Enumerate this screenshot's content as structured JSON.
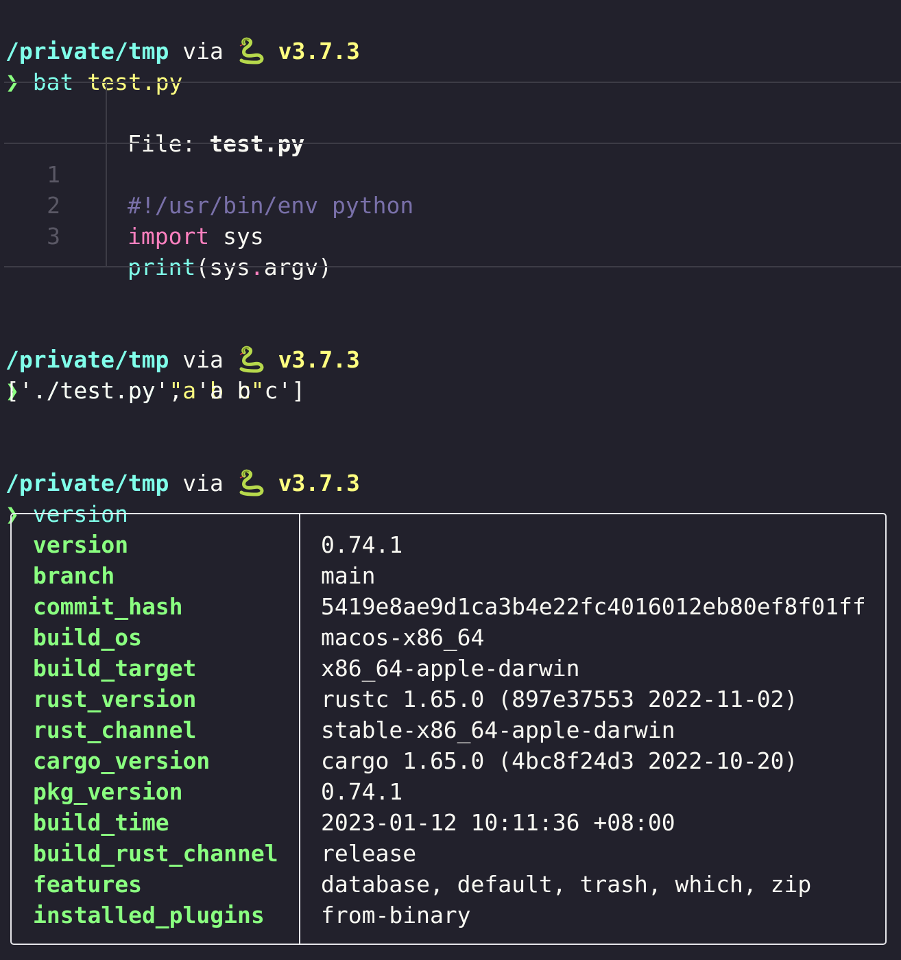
{
  "prompt1": {
    "path": "/private/tmp",
    "via": "via",
    "python_version": "v3.7.3",
    "chevron": "❯",
    "command": "bat",
    "argument": "test.py"
  },
  "bat": {
    "file_label": "File: ",
    "file_name": "test.py",
    "lines": [
      {
        "num": "1",
        "shebang": "#!/usr/bin/env python"
      },
      {
        "num": "2",
        "keyword": "import",
        "rest": " sys"
      },
      {
        "num": "3",
        "func": "print",
        "open": "(sys",
        "dot": ".",
        "close": "argv)"
      }
    ]
  },
  "prompt2": {
    "path": "/private/tmp",
    "via": "via",
    "python_version": "v3.7.3",
    "chevron": "❯",
    "command": "./test.py",
    "argument": "\"a b c\"",
    "output": "['./test.py', 'a b c']"
  },
  "prompt3": {
    "path": "/private/tmp",
    "via": "via",
    "python_version": "v3.7.3",
    "chevron": "❯",
    "command": "version"
  },
  "version_table": [
    {
      "key": "version",
      "value": "0.74.1"
    },
    {
      "key": "branch",
      "value": "main"
    },
    {
      "key": "commit_hash",
      "value": "5419e8ae9d1ca3b4e22fc4016012eb80ef8f01ff"
    },
    {
      "key": "build_os",
      "value": "macos-x86_64"
    },
    {
      "key": "build_target",
      "value": "x86_64-apple-darwin"
    },
    {
      "key": "rust_version",
      "value": "rustc 1.65.0 (897e37553 2022-11-02)"
    },
    {
      "key": "rust_channel",
      "value": "stable-x86_64-apple-darwin"
    },
    {
      "key": "cargo_version",
      "value": "cargo 1.65.0 (4bc8f24d3 2022-10-20)"
    },
    {
      "key": "pkg_version",
      "value": "0.74.1"
    },
    {
      "key": "build_time",
      "value": "2023-01-12 10:11:36 +08:00"
    },
    {
      "key": "build_rust_channel",
      "value": "release"
    },
    {
      "key": "features",
      "value": "database, default, trash, which, zip"
    },
    {
      "key": "installed_plugins",
      "value": "from-binary"
    }
  ],
  "icons": {
    "python": "snake-icon"
  },
  "colors": {
    "background": "#22212c",
    "path": "#80ffea",
    "version": "#ffff80",
    "key": "#8aff80",
    "keyword": "#ff80bf",
    "comment": "#7970a9"
  }
}
